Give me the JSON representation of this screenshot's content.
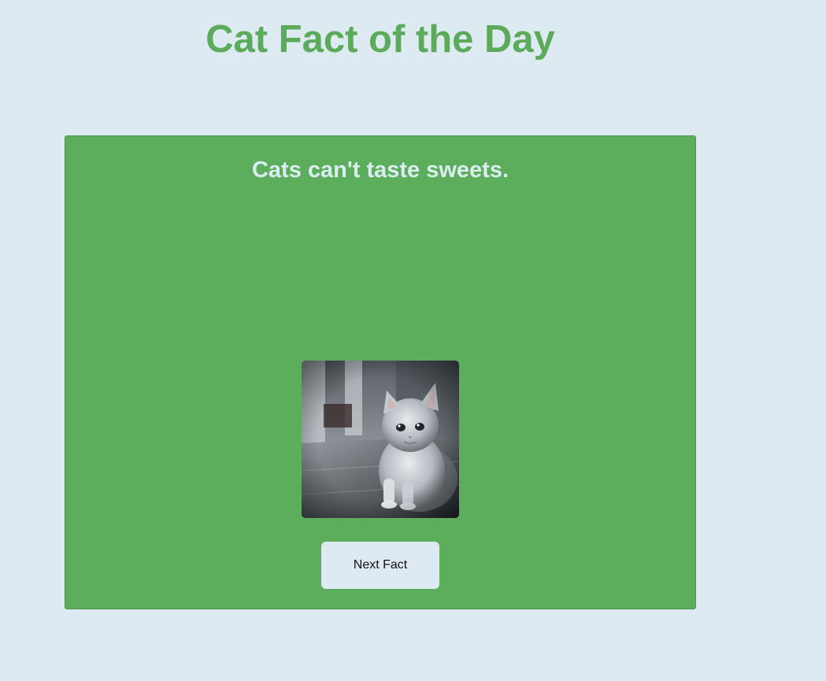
{
  "page": {
    "title": "Cat Fact of the Day"
  },
  "card": {
    "fact": "Cats can't taste sweets.",
    "image": {
      "alt": "kitten photo",
      "icon": "kitten-photo"
    },
    "next_button_label": "Next Fact"
  },
  "colors": {
    "background": "#deeaf1",
    "accent": "#5cab5b",
    "card": "#5cad5c",
    "fact_text": "#dcedf1"
  }
}
